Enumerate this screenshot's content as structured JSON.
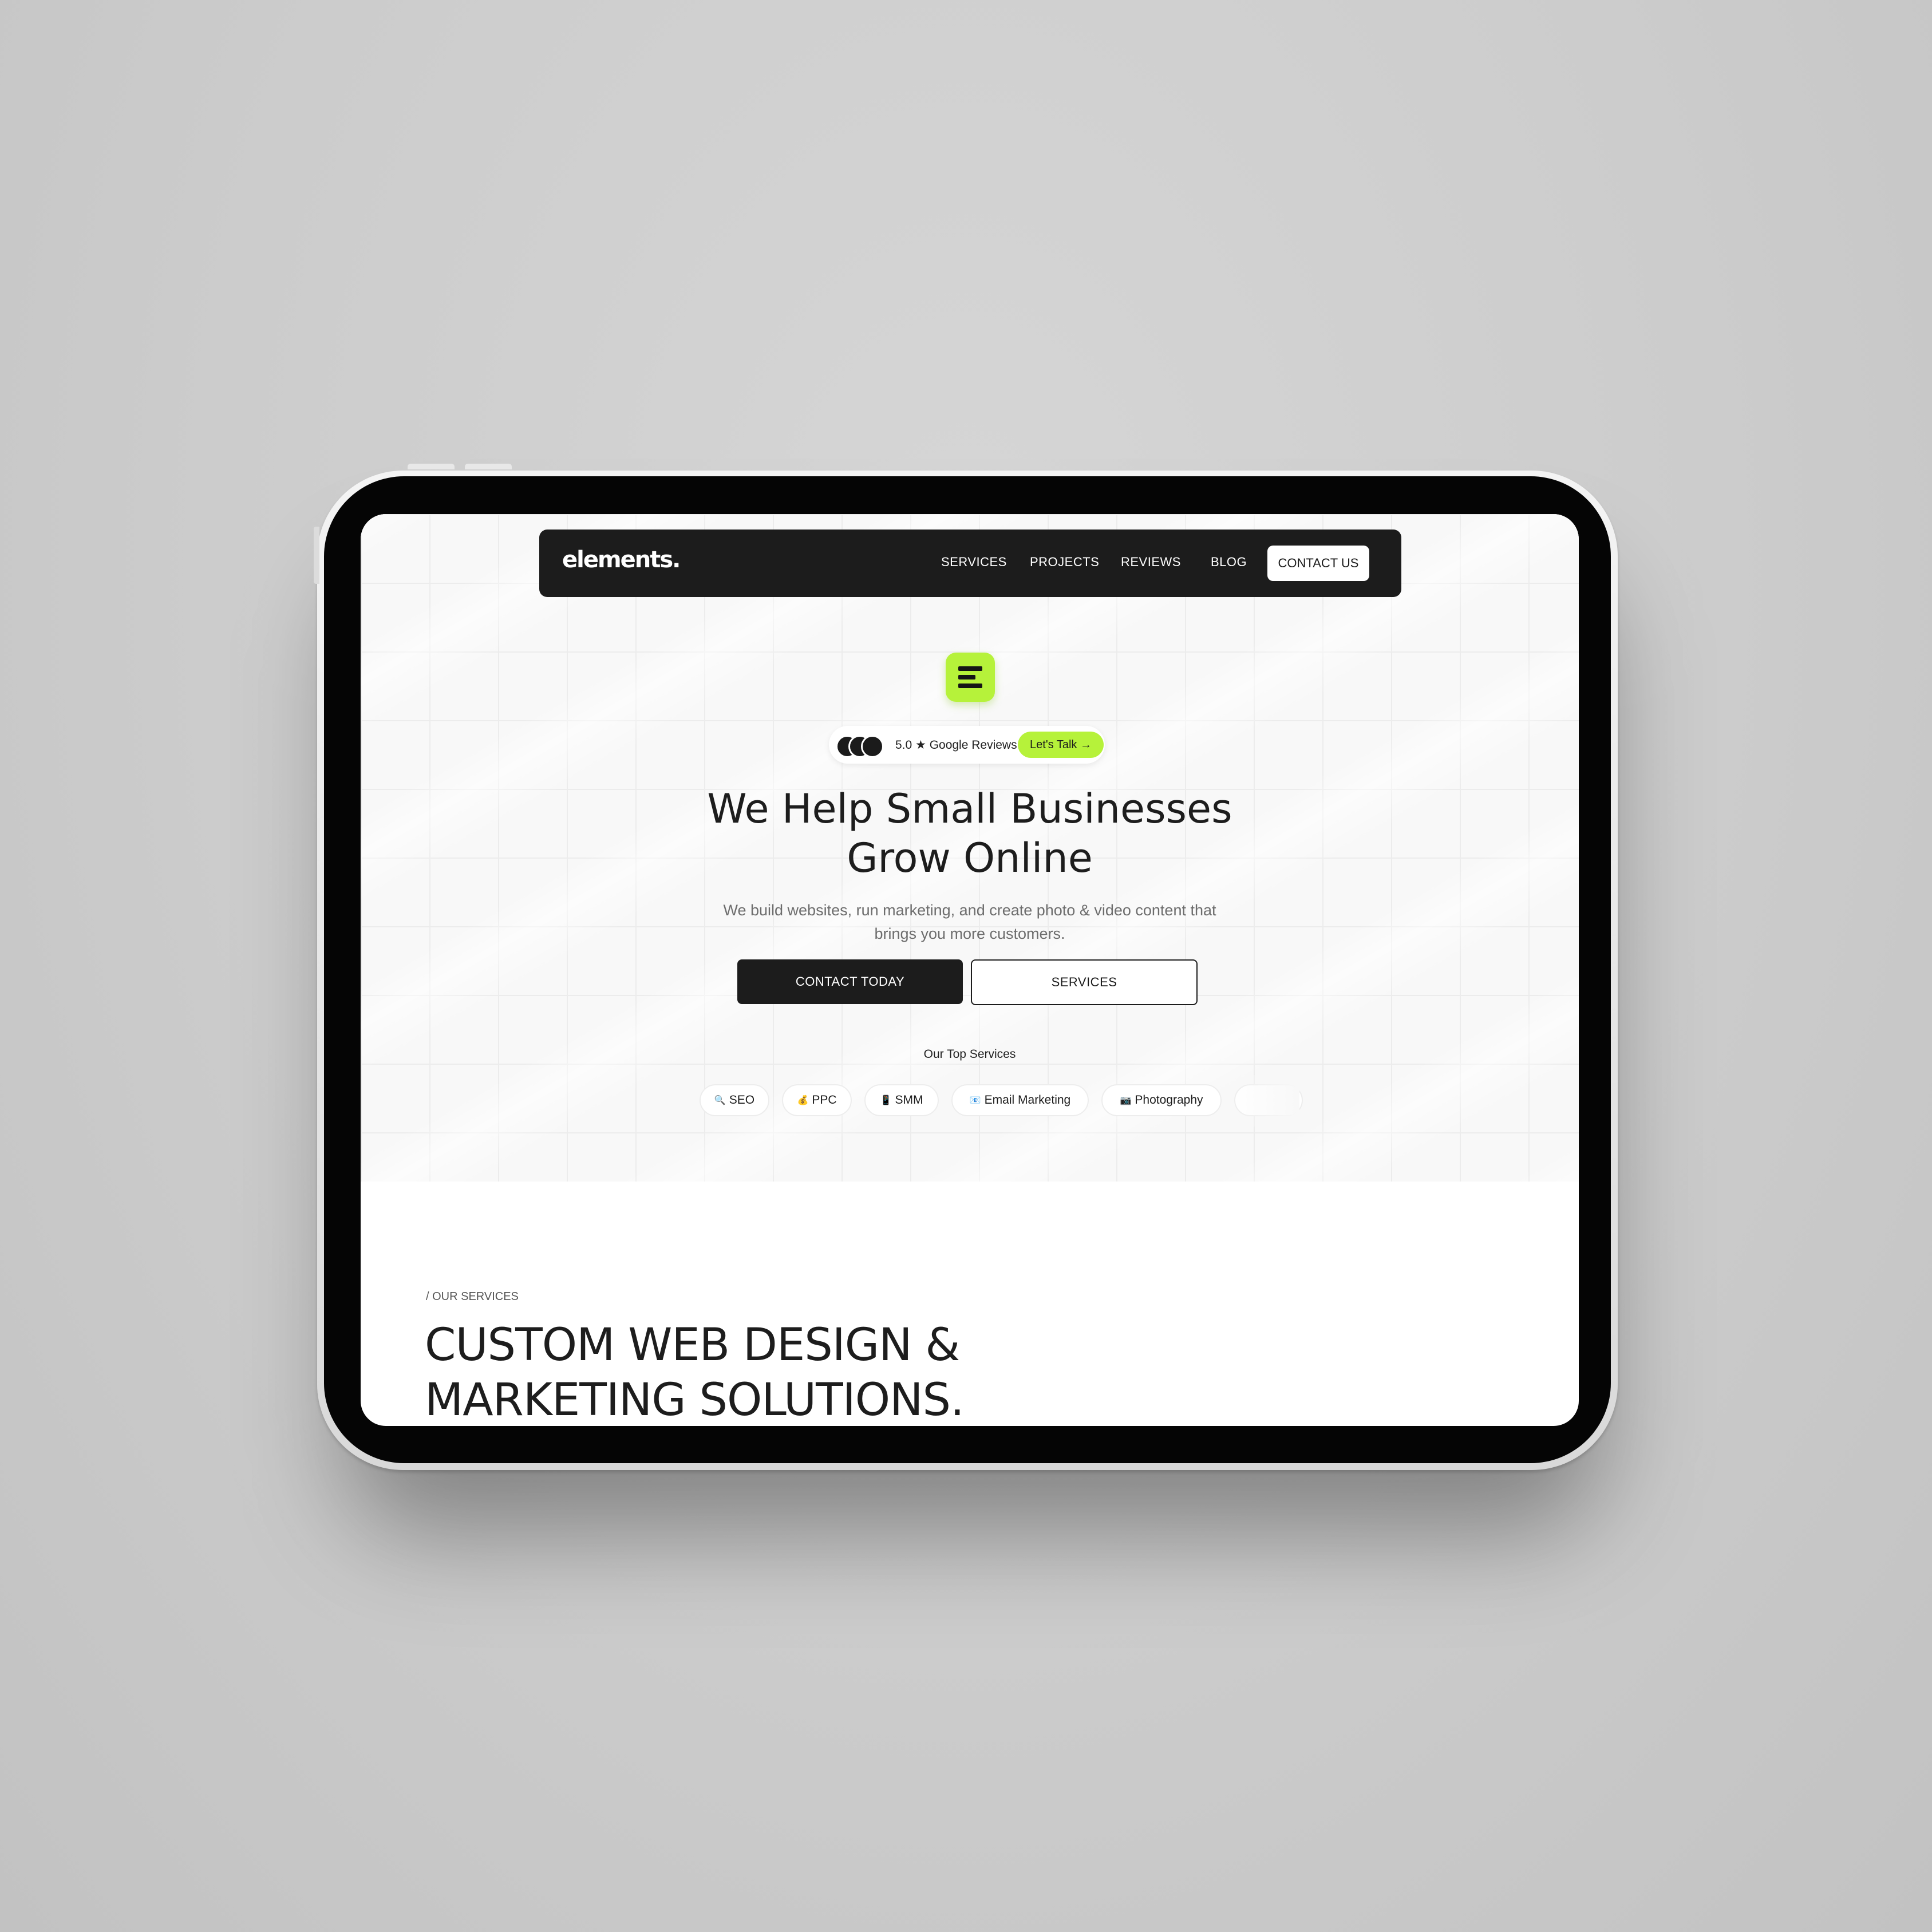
{
  "nav": {
    "logo": "elements.",
    "links": [
      "SERVICES",
      "PROJECTS",
      "REVIEWS",
      "BLOG"
    ],
    "cta": "CONTACT US"
  },
  "brand_badge": {
    "icon": "letter-e-mark-icon",
    "color": "#b6f23a"
  },
  "reviews": {
    "text": "5.0 ★ Google Reviews",
    "cta": "Let's Talk →"
  },
  "hero": {
    "headline_line1": "We Help Small Businesses",
    "headline_line2": "Grow Online",
    "sub_line1": "We build websites, run marketing, and create photo & video content that",
    "sub_line2": "brings you more customers.",
    "primary_button": "CONTACT TODAY",
    "secondary_button": "SERVICES"
  },
  "top_services": {
    "label": "Our Top Services",
    "chips": [
      {
        "icon": "🔍",
        "label": "SEO"
      },
      {
        "icon": "💰",
        "label": "PPC"
      },
      {
        "icon": "📱",
        "label": "SMM"
      },
      {
        "icon": "📧",
        "label": "Email Marketing"
      },
      {
        "icon": "📷",
        "label": "Photography"
      }
    ]
  },
  "services_section": {
    "eyebrow": "/ OUR SERVICES",
    "title_line1": "CUSTOM WEB DESIGN &",
    "title_line2": "MARKETING SOLUTIONS."
  },
  "colors": {
    "accent": "#b6f23a",
    "dark": "#1c1c1c",
    "background": "#cfcfcf"
  }
}
